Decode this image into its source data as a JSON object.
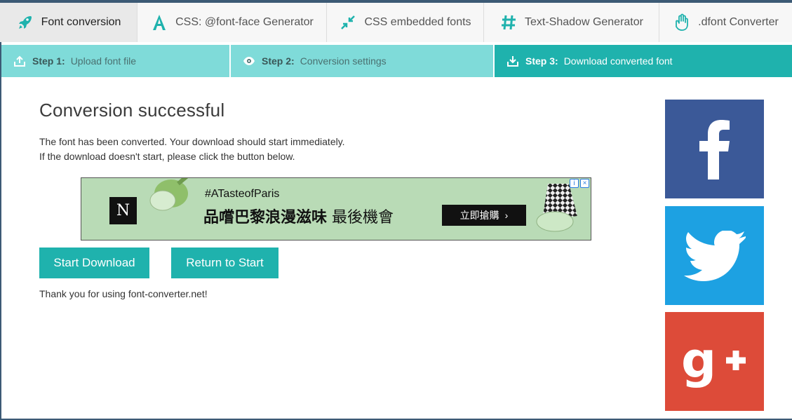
{
  "tabs": [
    {
      "label": "Font conversion",
      "icon": "rocket-icon",
      "active": true
    },
    {
      "label": "CSS: @font-face Generator",
      "icon": "letter-a-icon",
      "active": false
    },
    {
      "label": "CSS embedded fonts",
      "icon": "compress-arrows-icon",
      "active": false
    },
    {
      "label": "Text-Shadow Generator",
      "icon": "hash-icon",
      "active": false
    },
    {
      "label": ".dfont Converter",
      "icon": "hand-icon",
      "active": false
    }
  ],
  "steps": [
    {
      "num": "Step 1:",
      "label": "Upload font file",
      "icon": "upload-tray-icon"
    },
    {
      "num": "Step 2:",
      "label": "Conversion settings",
      "icon": "eye-icon"
    },
    {
      "num": "Step 3:",
      "label": "Download converted font",
      "icon": "download-tray-icon",
      "active": true
    }
  ],
  "main": {
    "title": "Conversion successful",
    "message_line1": "The font has been converted. Your download should start immediately.",
    "message_line2": "If the download doesn't start, please click the button below.",
    "start_download": "Start Download",
    "return_to_start": "Return to Start",
    "thanks": "Thank you for using font-converter.net!"
  },
  "ad": {
    "logo": "N",
    "hashtag": "#ATasteofParis",
    "headline_bold": "品嚐巴黎浪漫滋味",
    "headline_rest": "最後機會",
    "cta": "立即搶購",
    "cta_arrow": "›",
    "adchoice_info": "i",
    "adchoice_close": "×"
  },
  "social": {
    "facebook": "facebook-icon",
    "twitter": "twitter-icon",
    "googleplus": "google-plus-icon"
  },
  "colors": {
    "teal": "#1fb2ad",
    "teal_light": "#7fdbd9",
    "facebook": "#3b5998",
    "twitter": "#1da1e2",
    "googleplus": "#dd4b39"
  }
}
